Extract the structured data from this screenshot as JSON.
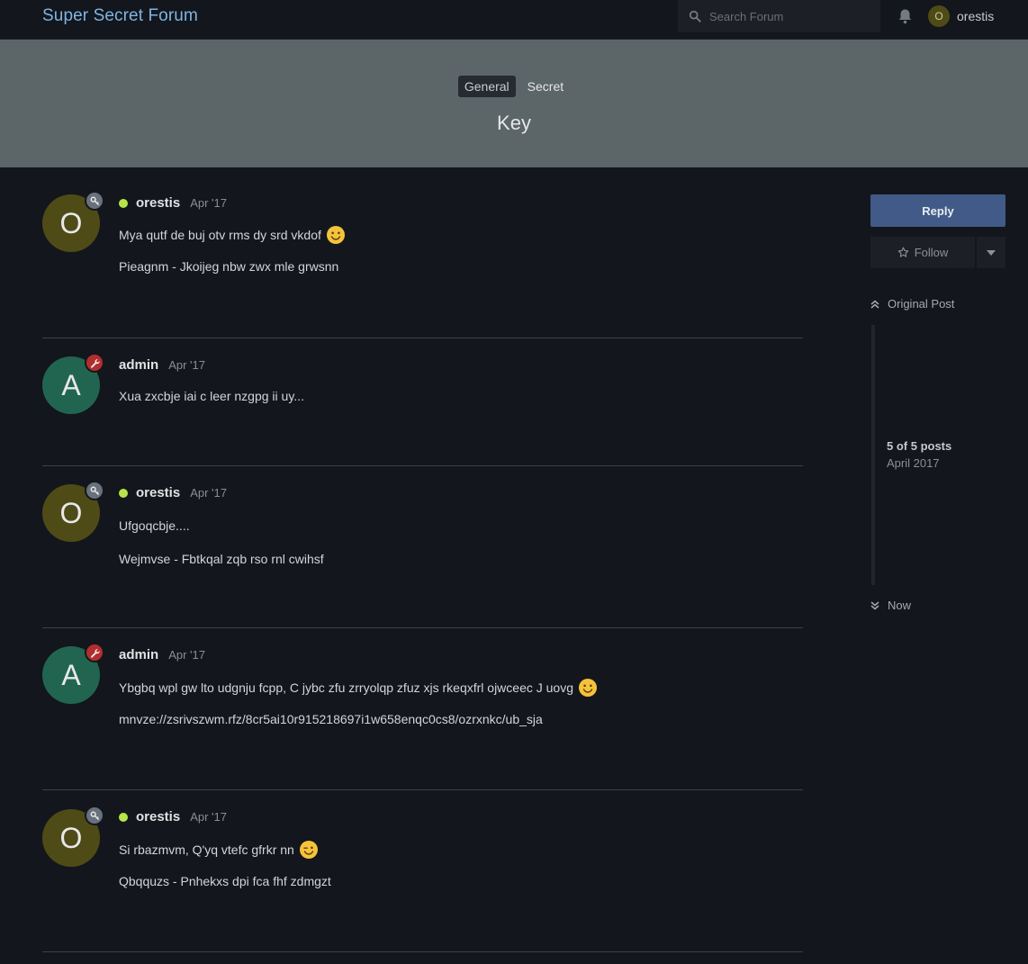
{
  "header": {
    "site_title": "Super Secret Forum",
    "search_placeholder": "Search Forum",
    "user_initial": "O",
    "username": "orestis"
  },
  "banner": {
    "categories": [
      "General",
      "Secret"
    ],
    "active_category": "General",
    "topic_title": "Key"
  },
  "posts": [
    {
      "initial": "O",
      "author": "orestis",
      "date": "Apr '17",
      "online": true,
      "badge": "key-icon",
      "lines": [
        "Mya qutf de buj otv rms dy srd vkdof",
        "Pieagnm - Jkoijeg nbw zwx mle grwsnn"
      ]
    },
    {
      "initial": "A",
      "author": "admin",
      "date": "Apr '17",
      "online": false,
      "badge": "wrench-icon",
      "lines": [
        "Xua zxcbje iai c leer nzgpg ii uy..."
      ]
    },
    {
      "initial": "O",
      "author": "orestis",
      "date": "Apr '17",
      "online": true,
      "badge": "key-icon",
      "lines": [
        "Ufgoqcbje....",
        "Wejmvse - Fbtkqal zqb rso rnl cwihsf"
      ]
    },
    {
      "initial": "A",
      "author": "admin",
      "date": "Apr '17",
      "online": false,
      "badge": "wrench-icon",
      "lines": [
        "Ybgbq wpl gw lto udgnju fcpp, C jybc zfu zrryolqp zfuz xjs rkeqxfrl ojwceec J uovg",
        "mnvze://zsrivszwm.rfz/8cr5ai10r915218697i1w658enqc0cs8/ozrxnkc/ub_sja"
      ]
    },
    {
      "initial": "O",
      "author": "orestis",
      "date": "Apr '17",
      "online": true,
      "badge": "key-icon",
      "lines": [
        "Si rbazmvm, Q'yq vtefc gfrkr nn",
        "Qbqquzs - Pnhekxs dpi fca fhf zdmgzt"
      ]
    }
  ],
  "sidebar": {
    "reply_label": "Reply",
    "follow_label": "Follow",
    "original_post_label": "Original Post",
    "position": "5 of 5 posts",
    "position_date": "April 2017",
    "now_label": "Now"
  }
}
